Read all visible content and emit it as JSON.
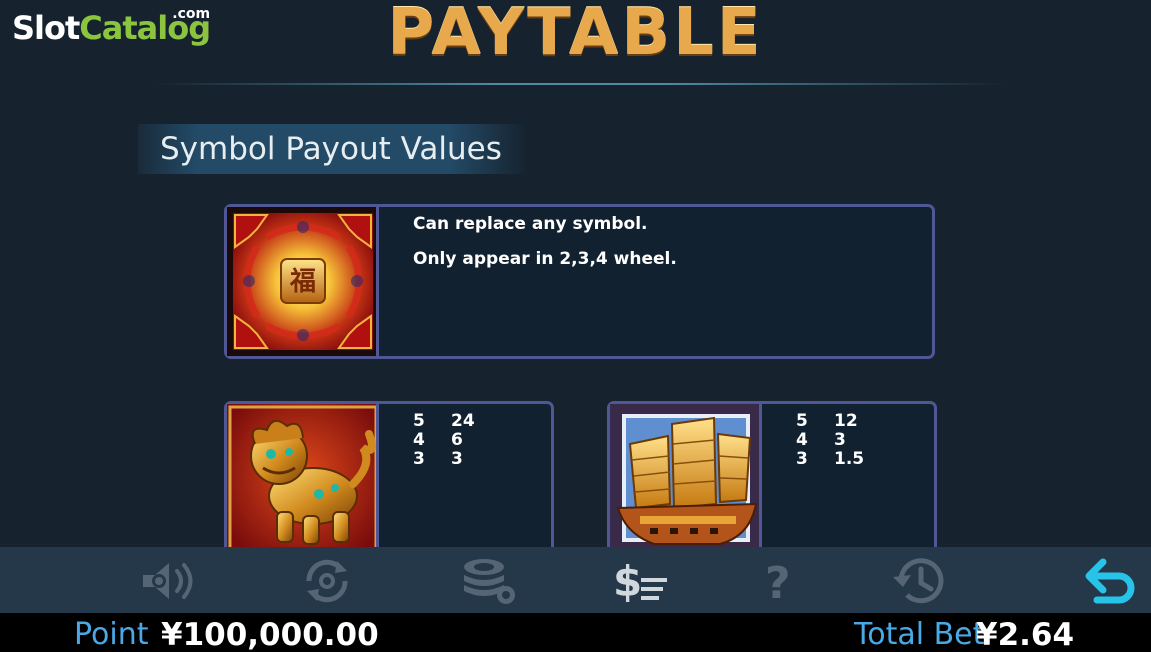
{
  "logo": {
    "part1": "Slot",
    "part2": "Catalog",
    "suffix": ".com"
  },
  "title": "PAYTABLE",
  "section_title": "Symbol Payout Values",
  "wild_card": {
    "symbol_name": "fu-wild-symbol",
    "lines": [
      "Can replace any symbol.",
      "Only appear in 2,3,4 wheel."
    ]
  },
  "pay_cards": [
    {
      "symbol_name": "golden-lion-symbol",
      "payouts": [
        {
          "count": "5",
          "value": "24"
        },
        {
          "count": "4",
          "value": "6"
        },
        {
          "count": "3",
          "value": "3"
        }
      ]
    },
    {
      "symbol_name": "junk-ship-symbol",
      "payouts": [
        {
          "count": "5",
          "value": "12"
        },
        {
          "count": "4",
          "value": "3"
        },
        {
          "count": "3",
          "value": "1.5"
        }
      ]
    }
  ],
  "toolbar": {
    "buttons": [
      "sound-icon",
      "autoplay-icon",
      "chips-icon",
      "paytable-icon",
      "help-icon",
      "history-icon",
      "back-icon"
    ],
    "active": "paytable-icon"
  },
  "footer": {
    "point_label": "Point",
    "point_value": "¥100,000.00",
    "bet_label": "Total Bet",
    "bet_value": "¥2.64"
  },
  "colors": {
    "background": "#16222e",
    "title_gold": "#e7a94c",
    "card_border": "#4f5794",
    "label_blue": "#4aa8e6",
    "back_cyan": "#27c3e8",
    "icon_inactive": "#556575"
  }
}
